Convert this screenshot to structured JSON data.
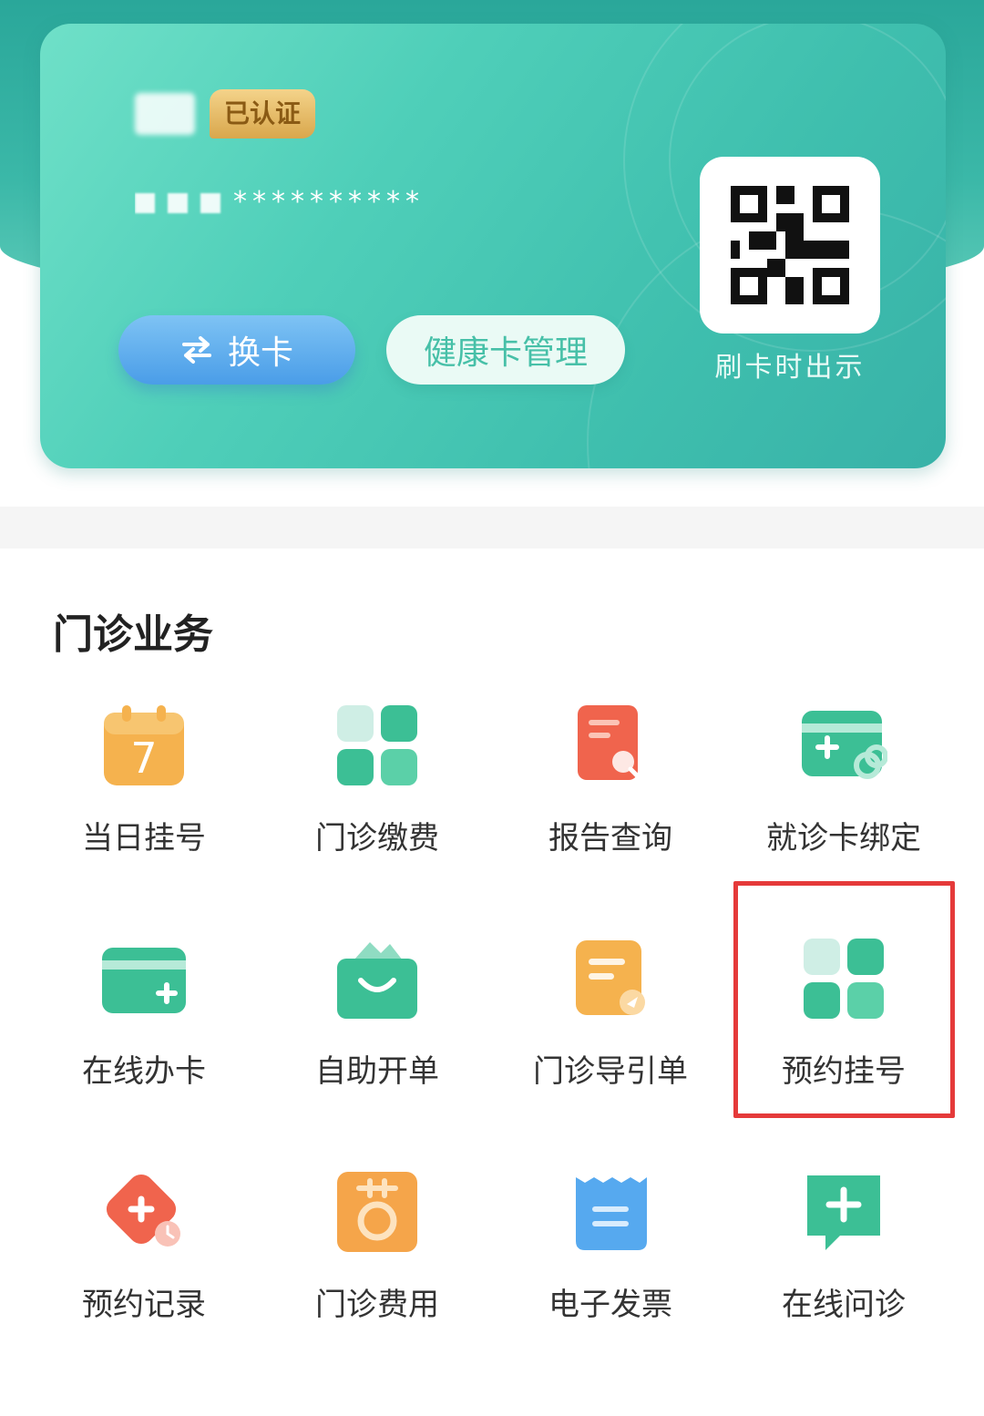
{
  "card": {
    "verify_label": "已认证",
    "number_masked": "**********",
    "switch_label": "换卡",
    "manage_label": "健康卡管理",
    "qr_caption": "刷卡时出示"
  },
  "section": {
    "title": "门诊业务"
  },
  "services": [
    {
      "label": "当日挂号",
      "icon": "calendar-7-icon"
    },
    {
      "label": "门诊缴费",
      "icon": "grid-icon"
    },
    {
      "label": "报告查询",
      "icon": "report-search-icon"
    },
    {
      "label": "就诊卡绑定",
      "icon": "card-link-icon"
    },
    {
      "label": "在线办卡",
      "icon": "card-add-icon"
    },
    {
      "label": "自助开单",
      "icon": "bag-icon"
    },
    {
      "label": "门诊导引单",
      "icon": "guide-doc-icon"
    },
    {
      "label": "预约挂号",
      "icon": "grid-icon"
    },
    {
      "label": "预约记录",
      "icon": "cross-clock-icon"
    },
    {
      "label": "门诊费用",
      "icon": "fee-icon"
    },
    {
      "label": "电子发票",
      "icon": "receipt-icon"
    },
    {
      "label": "在线问诊",
      "icon": "chat-plus-icon"
    }
  ],
  "colors": {
    "teal": "#3fbfae",
    "green": "#3dc39a",
    "orange": "#f5a54a",
    "red": "#f0644d",
    "blue": "#4a9de8",
    "highlight": "#e53a3a"
  }
}
